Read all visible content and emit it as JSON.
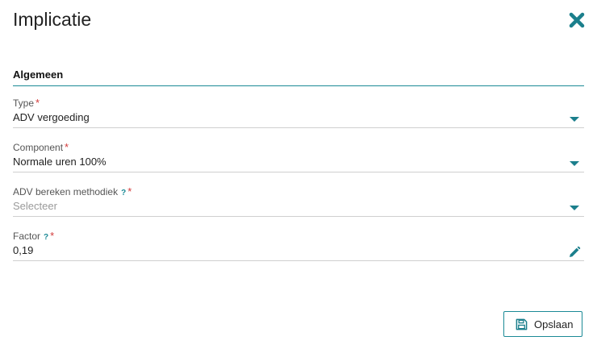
{
  "dialog": {
    "title": "Implicatie"
  },
  "section": {
    "title": "Algemeen"
  },
  "fields": {
    "type": {
      "label": "Type",
      "required_mark": "*",
      "value": "ADV vergoeding"
    },
    "component": {
      "label": "Component",
      "required_mark": "*",
      "value": "Normale uren 100%"
    },
    "adv_method": {
      "label": "ADV bereken methodiek",
      "help_mark": "?",
      "required_mark": "*",
      "placeholder": "Selecteer"
    },
    "factor": {
      "label": "Factor",
      "help_mark": "?",
      "required_mark": "*",
      "value": "0,19"
    }
  },
  "footer": {
    "save_label": "Opslaan"
  },
  "colors": {
    "accent": "#1b8a96",
    "required": "#d23a3a"
  },
  "icons": {
    "close": "close-icon",
    "dropdown": "caret-down-icon",
    "edit": "pencil-icon",
    "save": "floppy-disk-icon"
  }
}
